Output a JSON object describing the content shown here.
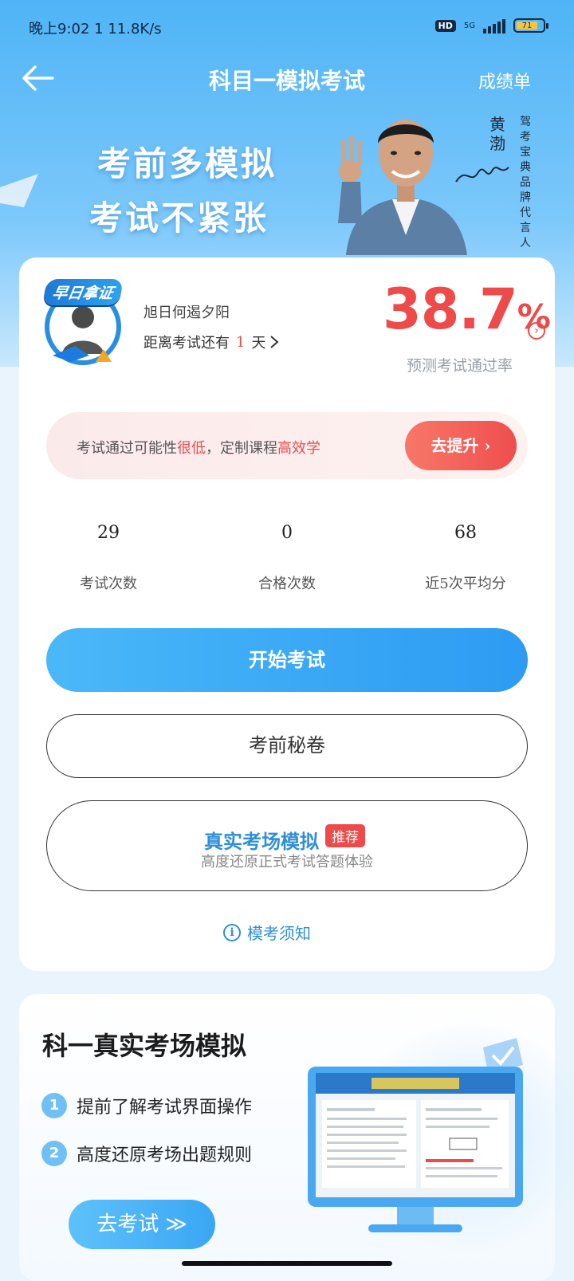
{
  "status_bar": {
    "time": "晚上9:02",
    "net_speed": "1 11.8K/s",
    "hd": "HD",
    "network": "5G",
    "battery": "71"
  },
  "header": {
    "title": "科目一模拟考试",
    "right_link": "成绩单"
  },
  "banner": {
    "line1": "考前多模拟",
    "line2": "考试不紧张",
    "endorser_name": "黄渤",
    "endorser_role": "驾考宝典品牌代言人"
  },
  "profile": {
    "badge": "早日拿证",
    "username": "旭日何遏夕阳",
    "countdown_prefix": "距离考试还有",
    "countdown_days": "1",
    "countdown_suffix": "天",
    "pass_rate_value": "38.7",
    "pass_rate_unit": "%",
    "pass_rate_label": "预测考试通过率"
  },
  "tip": {
    "part1": "考试通过可能性",
    "highlight1": "很低",
    "part2": "，定制课程",
    "highlight2": "高效学",
    "button": "去提升"
  },
  "stats": [
    {
      "value": "29",
      "label": "考试次数"
    },
    {
      "value": "0",
      "label": "合格次数"
    },
    {
      "value": "68",
      "label": "近5次平均分"
    }
  ],
  "actions": {
    "start": "开始考试",
    "secret": "考前秘卷",
    "real_title": "真实考场模拟",
    "real_tag": "推荐",
    "real_sub": "高度还原正式考试答题体验",
    "notice": "模考须知"
  },
  "real_card": {
    "title": "科一真实考场模拟",
    "features": [
      {
        "num": "1",
        "text": "提前了解考试界面操作"
      },
      {
        "num": "2",
        "text": "高度还原考场出题规则"
      }
    ],
    "go_button": "去考试 ≫"
  },
  "colors": {
    "primary": "#2d9bf2",
    "accent_red": "#ee4a4a"
  }
}
